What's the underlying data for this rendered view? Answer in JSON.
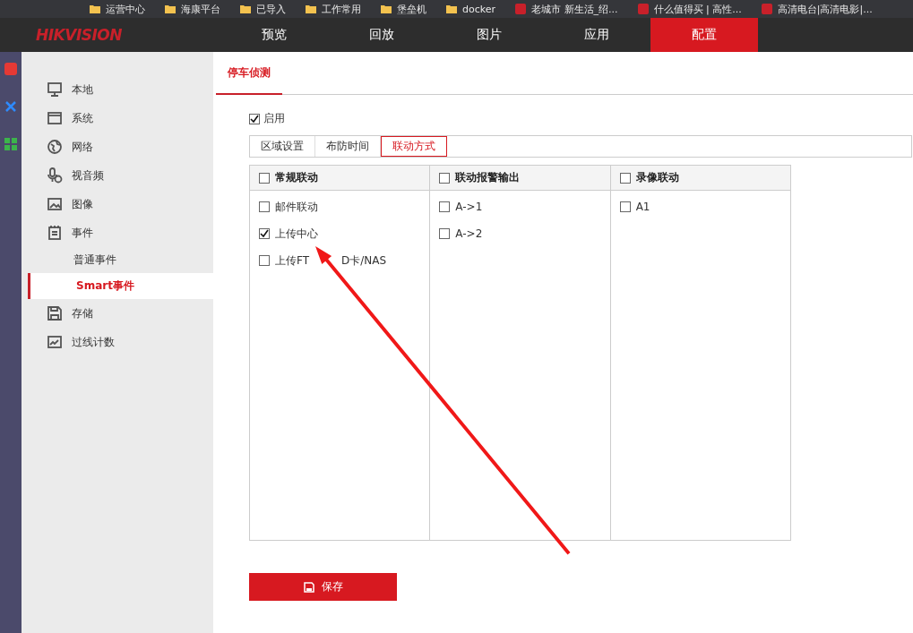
{
  "bookmarks": [
    {
      "label": "运营中心",
      "kind": "folder"
    },
    {
      "label": "海康平台",
      "kind": "folder"
    },
    {
      "label": "已导入",
      "kind": "folder"
    },
    {
      "label": "工作常用",
      "kind": "folder"
    },
    {
      "label": "堡垒机",
      "kind": "folder"
    },
    {
      "label": "docker",
      "kind": "folder"
    },
    {
      "label": "老城市 新生活_绍...",
      "kind": "site"
    },
    {
      "label": "什么值得买 | 高性...",
      "kind": "site"
    },
    {
      "label": "高清电台|高清电影|...",
      "kind": "site"
    }
  ],
  "logo": "HIKVISION",
  "nav": [
    {
      "label": "预览",
      "selected": false
    },
    {
      "label": "回放",
      "selected": false
    },
    {
      "label": "图片",
      "selected": false
    },
    {
      "label": "应用",
      "selected": false
    },
    {
      "label": "配置",
      "selected": true
    }
  ],
  "sidebar": {
    "items": [
      {
        "label": "本地",
        "selected": false
      },
      {
        "label": "系统",
        "selected": false
      },
      {
        "label": "网络",
        "selected": false
      },
      {
        "label": "视音频",
        "selected": false
      },
      {
        "label": "图像",
        "selected": false
      },
      {
        "label": "事件",
        "selected": false,
        "children": [
          {
            "label": "普通事件",
            "selected": false
          },
          {
            "label": "Smart事件",
            "selected": true
          }
        ]
      },
      {
        "label": "存储",
        "selected": false
      },
      {
        "label": "过线计数",
        "selected": false
      }
    ]
  },
  "page_tabs": [
    {
      "label": "停车侦测",
      "selected": true
    }
  ],
  "enable": {
    "label": "启用",
    "checked": true
  },
  "steps": [
    {
      "label": "区域设置",
      "selected": false
    },
    {
      "label": "布防时间",
      "selected": false
    },
    {
      "label": "联动方式",
      "selected": true
    }
  ],
  "columns": [
    {
      "label": "常规联动",
      "checked": false,
      "items": [
        {
          "label": "邮件联动",
          "checked": false
        },
        {
          "label": "上传中心",
          "checked": true
        },
        {
          "label": "上传FT",
          "label_end": "D卡/NAS",
          "checked": false
        }
      ]
    },
    {
      "label": "联动报警输出",
      "checked": false,
      "items": [
        {
          "label": "A->1",
          "checked": false
        },
        {
          "label": "A->2",
          "checked": false
        }
      ]
    },
    {
      "label": "录像联动",
      "checked": false,
      "items": [
        {
          "label": "A1",
          "checked": false
        }
      ]
    }
  ],
  "save_button": "保存"
}
